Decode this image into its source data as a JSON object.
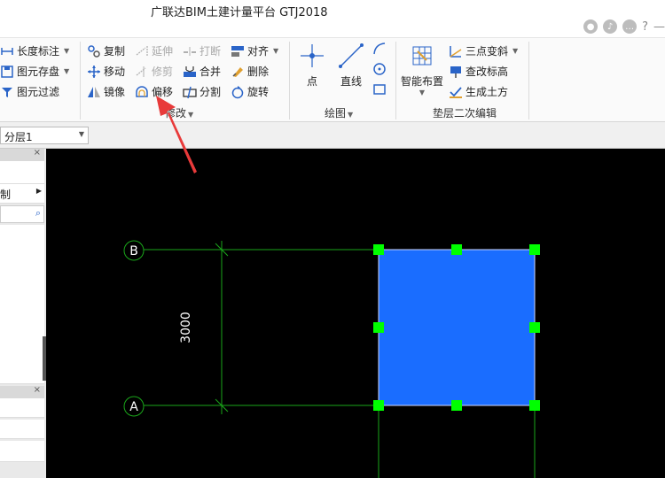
{
  "app": {
    "title": "广联达BIM土建计量平台 GTJ2018"
  },
  "titlebar_icons": [
    "user-icon",
    "bell-icon",
    "chat-icon",
    "help-icon",
    "minimize-icon"
  ],
  "ribbon": {
    "left_group": {
      "items": [
        "长度标注",
        "图元存盘",
        "图元过滤"
      ]
    },
    "modify_group": {
      "label": "修改",
      "items": {
        "copy": "复制",
        "extend": "延伸",
        "break": "打断",
        "align": "对齐",
        "move": "移动",
        "trim": "修剪",
        "merge": "合并",
        "delete": "删除",
        "mirror": "镜像",
        "offset": "偏移",
        "split": "分割",
        "rotate": "旋转"
      }
    },
    "draw_group": {
      "label": "绘图",
      "point": "点",
      "line": "直线"
    },
    "cushion_group": {
      "label": "垫层二次编辑",
      "smart_layout": "智能布置",
      "three_point_slope": "三点变斜",
      "check_elevation": "查改标高",
      "generate_earthwork": "生成土方"
    }
  },
  "subbar": {
    "layer_value": "分层1"
  },
  "left_panel": {
    "row_label": "制"
  },
  "canvas": {
    "axis_b": "B",
    "axis_a": "A",
    "dimension": "3000",
    "colors": {
      "background": "#000000",
      "grid_line": "#1aa61a",
      "selected_fill": "#1a6dff",
      "grip": "#00ff00",
      "annotation_arrow": "#e83a3a"
    }
  }
}
